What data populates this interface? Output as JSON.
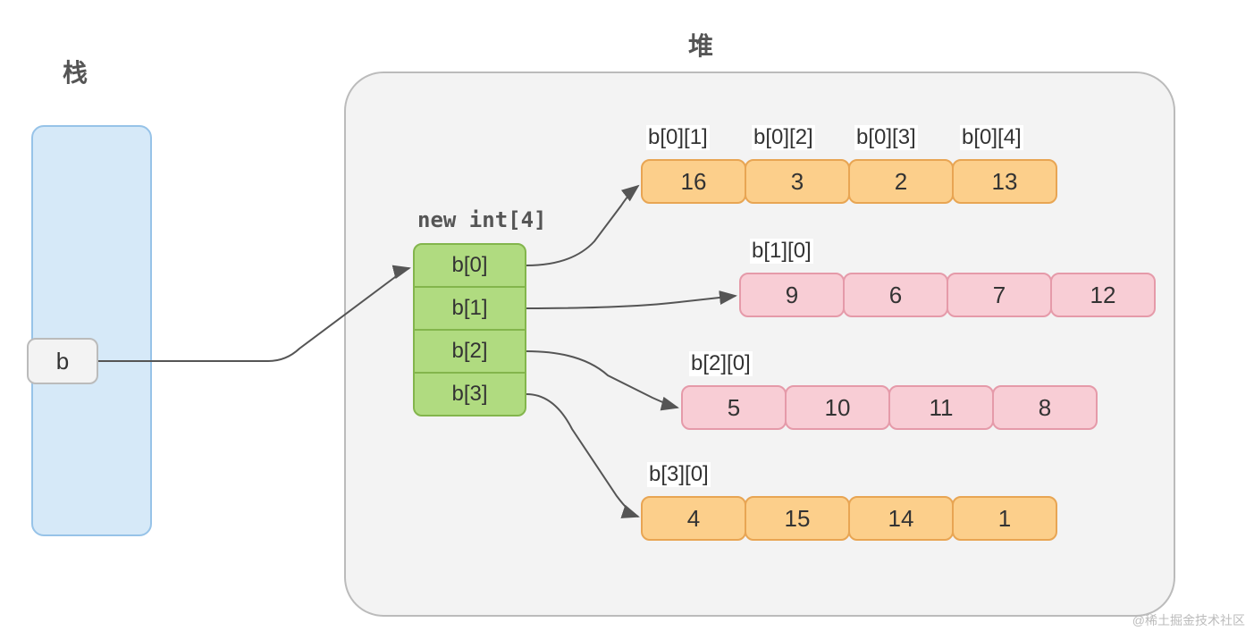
{
  "titles": {
    "stack": "栈",
    "heap": "堆"
  },
  "variable": "b",
  "new_int_label": "new int[4]",
  "outer": [
    "b[0]",
    "b[1]",
    "b[2]",
    "b[3]"
  ],
  "row0_labels": [
    "b[0][1]",
    "b[0][2]",
    "b[0][3]",
    "b[0][4]"
  ],
  "row1_label": "b[1][0]",
  "row2_label": "b[2][0]",
  "row3_label": "b[3][0]",
  "row0": [
    "16",
    "3",
    "2",
    "13"
  ],
  "row1": [
    "9",
    "6",
    "7",
    "12"
  ],
  "row2": [
    "5",
    "10",
    "11",
    "8"
  ],
  "row3": [
    "4",
    "15",
    "14",
    "1"
  ],
  "watermark": "@稀土掘金技术社区"
}
